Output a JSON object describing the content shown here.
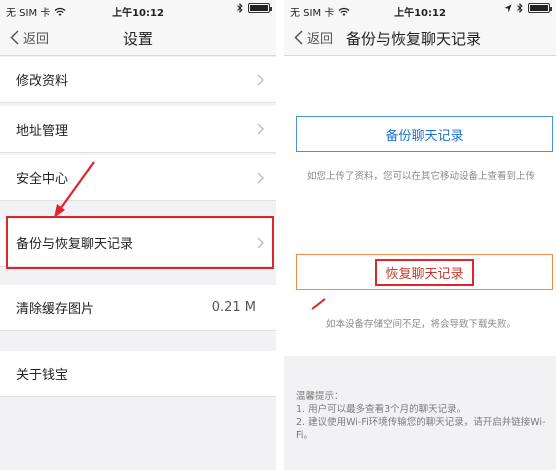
{
  "status": {
    "carrier": "无 SIM 卡",
    "time": "上午10:12"
  },
  "settings": {
    "back_label": "返回",
    "title": "设置",
    "items": [
      {
        "label": "修改资料",
        "value": ""
      },
      {
        "label": "地址管理",
        "value": ""
      },
      {
        "label": "安全中心",
        "value": ""
      },
      {
        "label": "备份与恢复聊天记录",
        "value": ""
      },
      {
        "label": "清除缓存图片",
        "value": "0.21 M"
      },
      {
        "label": "关于钱宝",
        "value": ""
      }
    ]
  },
  "backup": {
    "back_label": "返回",
    "title": "备份与恢复聊天记录",
    "backup_button": "备份聊天记录",
    "backup_note": "如您上传了资料，您可以在其它移动设备上查看到上传",
    "restore_button": "恢复聊天记录",
    "restore_note": "如本设备存储空间不足，将会导致下载失败。",
    "tips_title": "温馨提示：",
    "tips": [
      "1. 用户可以最多查看3个月的聊天记录。",
      "2. 建议使用Wi-Fi环境传输您的聊天记录，请开启并链接Wi-Fi。"
    ]
  },
  "colors": {
    "highlight": "#e0242b",
    "link_blue": "#1a73c8"
  }
}
